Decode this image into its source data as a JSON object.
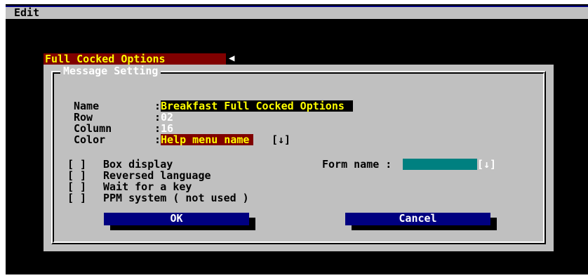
{
  "menubar": {
    "edit_label": "Edit"
  },
  "dialog_title": "Full Cocked Options",
  "frame_title": "Message Setting",
  "fields": {
    "name_label": "Name",
    "name_value": "Breakfast Full Cocked Options",
    "row_label": "Row",
    "row_value": "02",
    "column_label": "Column",
    "column_value": "16",
    "color_label": "Color",
    "color_value": "Help menu name",
    "color_dropdown": "[↓]"
  },
  "checkboxes": [
    {
      "box": "[ ]",
      "label": "Box display"
    },
    {
      "box": "[ ]",
      "label": "Reversed language"
    },
    {
      "box": "[ ]",
      "label": "Wait for a key"
    },
    {
      "box": "[ ]",
      "label": "PPM system ( not used )"
    }
  ],
  "form": {
    "label": "Form name :",
    "dropdown": "[↓]"
  },
  "buttons": {
    "ok": "OK",
    "cancel": "Cancel"
  },
  "colors": {
    "title_bg": "#800000",
    "title_fg": "#ffff00",
    "dialog_bg": "#c0c0c0",
    "button_bg": "#000080",
    "field_teal": "#008080"
  }
}
